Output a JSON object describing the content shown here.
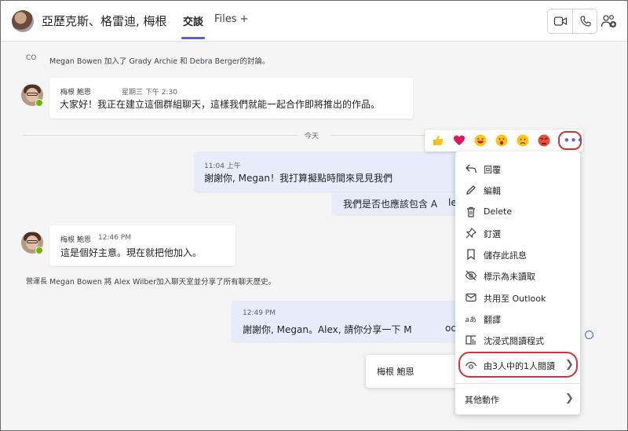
{
  "header": {
    "title": "亞歷克斯、格雷迪, 梅根",
    "tabs": [
      {
        "label": "交談",
        "active": true
      },
      {
        "label": "Files +"
      }
    ],
    "actions": [
      "video-call-icon",
      "phone-call-icon",
      "people-add-icon"
    ],
    "accent": "#5b5fc7",
    "highlight": "#d13438"
  },
  "system_messages": [
    {
      "text": "Megan Bowen 加入了 Grady Archie 和 Debra Berger的討論。",
      "icon": "CO"
    },
    {
      "text": "Megan Bowen 將 Alex Wilber加入聊天室並分享了所有聊天歷史。",
      "icon": "營運長"
    }
  ],
  "messages": [
    {
      "sender": "梅根 鮑恩",
      "time": "星期三 下午 2:30",
      "text": "大家好！我正在建立這個群組聊天，這樣我們就能一起合作即將推出的作品。"
    },
    {
      "time": "11:04 上午",
      "text": "謝謝你, Megan！我打算擬點時間來見見我們",
      "mine": true
    },
    {
      "text": "我們是否也應該包含 A",
      "text_tail": "le",
      "mine": true
    },
    {
      "sender": "梅根 鮑恩",
      "time": "12:46 PM",
      "text": "這是個好主意。現在就把他加入。"
    },
    {
      "time": "12:49 PM",
      "text": "謝謝你, Megan。Alex, 請你分享一下 M",
      "text_tail": "oc",
      "mine": true
    }
  ],
  "divider": {
    "label": "今天"
  },
  "reactions": [
    "like-icon",
    "heart-icon",
    "laugh-icon",
    "surprised-icon",
    "sad-icon",
    "angry-icon"
  ],
  "context_menu": {
    "items": [
      {
        "label": "回覆",
        "icon": "reply-icon"
      },
      {
        "label": "編輯",
        "icon": "edit-icon"
      },
      {
        "label": "Delete",
        "icon": "delete-icon"
      },
      {
        "label": "釘選",
        "icon": "pin-icon"
      },
      {
        "label": "儲存此訊息",
        "icon": "bookmark-icon"
      },
      {
        "label": "標示為未讀取",
        "icon": "mark-unread-icon"
      },
      {
        "label": "共用至 Outlook",
        "icon": "outlook-icon"
      },
      {
        "label": "翻譯",
        "icon": "translate-icon"
      },
      {
        "label": "沈浸式閱讀程式",
        "icon": "immersive-reader-icon"
      },
      {
        "label": "由3人中的1人閱讀",
        "icon": "eye-icon"
      }
    ],
    "more_actions": "其他動作"
  },
  "seen_by": {
    "name": "梅根 鮑恩"
  }
}
